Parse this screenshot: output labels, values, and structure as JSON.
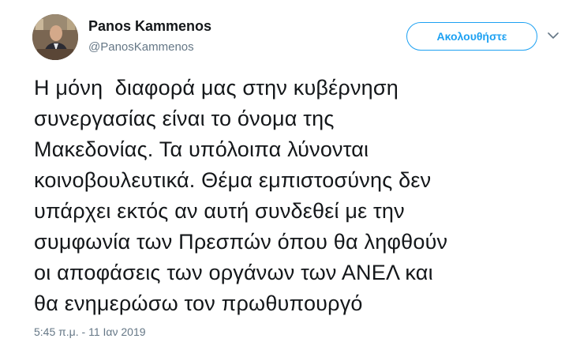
{
  "author": {
    "display_name": "Panos Kammenos",
    "screen_name": "@PanosKammenos",
    "avatar_icon": "profile-photo"
  },
  "actions": {
    "follow_label": "Ακολουθήστε",
    "more_icon": "chevron-down-icon"
  },
  "tweet": {
    "lines": [
      "Η μόνη  διαφορά μας στην κυβέρνηση",
      "συνεργασίας είναι το όνομα της",
      "Μακεδονίας. Τα υπόλοιπα λύνονται",
      "κοινοβουλευτικά. Θέμα εμπιστοσύνης δεν",
      "υπάρχει εκτός αν αυτή συνδεθεί με την",
      "συμφωνία των Πρεσπών όπου θα ληφθούν",
      "οι αποφάσεις των οργάνων των ΑΝΕΛ και",
      "θα ενημερώσω τον πρωθυπουργό"
    ],
    "timestamp": "5:45 π.μ. - 11 Ιαν 2019"
  },
  "colors": {
    "accent": "#1da1f2",
    "secondary_text": "#657786",
    "primary_text": "#14171a"
  }
}
